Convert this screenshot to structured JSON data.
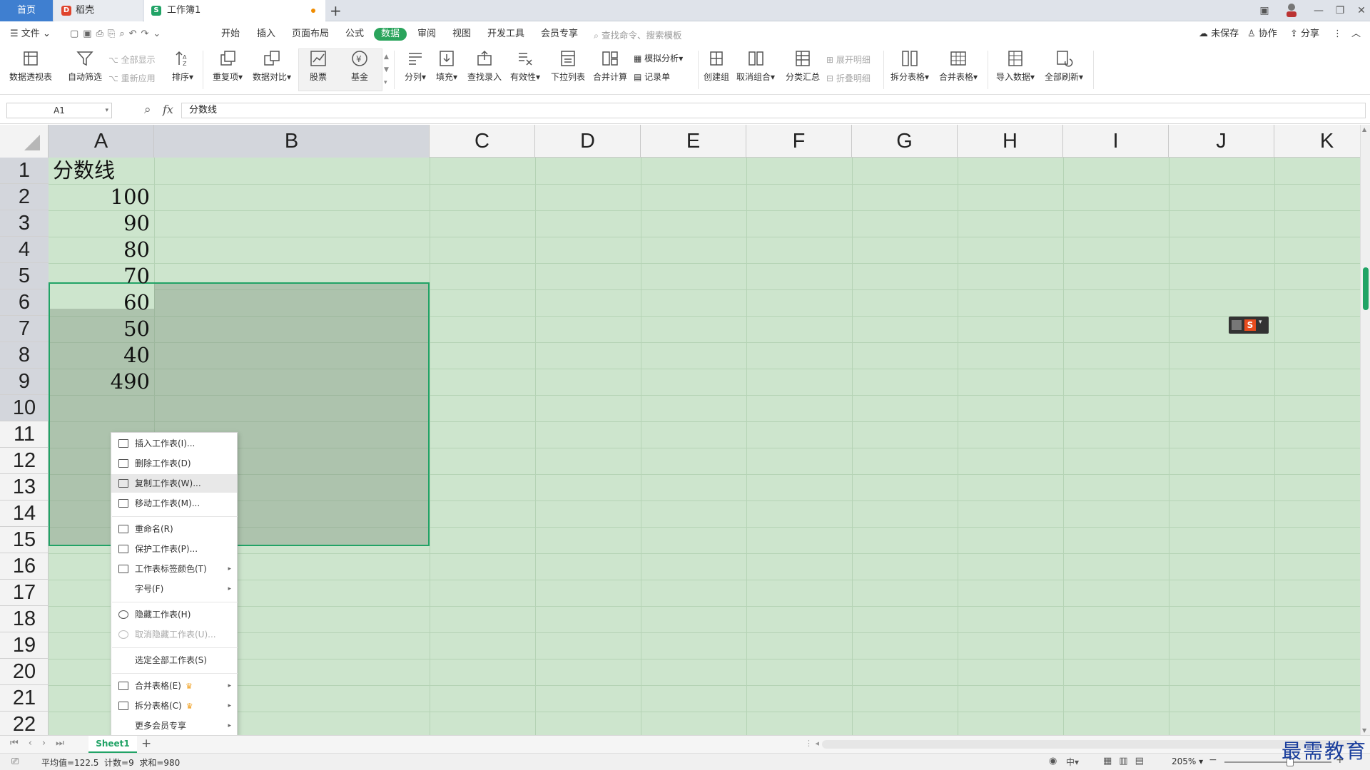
{
  "titlebar": {
    "tab_home": "首页",
    "tab_docer": "稻壳",
    "tab_doc": "工作簿1",
    "new_tab": "+"
  },
  "menu": {
    "file": "文件",
    "items": [
      "开始",
      "插入",
      "页面布局",
      "公式",
      "数据",
      "审阅",
      "视图",
      "开发工具",
      "会员专享"
    ],
    "active": "数据",
    "search_placeholder": "查找命令、搜索模板",
    "unsaved": "未保存",
    "collab": "协作",
    "share": "分享"
  },
  "ribbon": {
    "pivot": "数据透视表",
    "autofilter": "自动筛选",
    "show_all": "全部显示",
    "reapply": "重新应用",
    "sort": "排序",
    "duplicates": "重复项",
    "compare": "数据对比",
    "stock": "股票",
    "fund": "基金",
    "split_col": "分列",
    "fill": "填充",
    "lookup": "查找录入",
    "validity": "有效性",
    "dropdown": "下拉列表",
    "consolidate": "合并计算",
    "whatif": "模拟分析",
    "record": "记录单",
    "group": "创建组",
    "ungroup": "取消组合",
    "subtotal": "分类汇总",
    "expand": "展开明细",
    "collapse": "折叠明细",
    "split_table": "拆分表格",
    "merge_table": "合并表格",
    "import": "导入数据",
    "refresh_all": "全部刷新"
  },
  "formula_bar": {
    "name_box": "A1",
    "fx": "fx",
    "content": "分数线"
  },
  "columns": [
    "A",
    "B",
    "C",
    "D",
    "E",
    "F",
    "G",
    "H",
    "I",
    "J",
    "K"
  ],
  "rows": [
    "1",
    "2",
    "3",
    "4",
    "5",
    "6",
    "7",
    "8",
    "9",
    "10",
    "11",
    "12",
    "13",
    "14",
    "15",
    "16",
    "17",
    "18",
    "19",
    "20",
    "21",
    "22"
  ],
  "cells": {
    "A1": "分数线",
    "A2": "100",
    "A3": "90",
    "A4": "80",
    "A5": "70",
    "A6": "60",
    "A7": "50",
    "A8": "40",
    "A9": "490"
  },
  "context_menu": [
    {
      "label": "插入工作表(I)..."
    },
    {
      "label": "删除工作表(D)"
    },
    {
      "label": "复制工作表(W)..."
    },
    {
      "label": "移动工作表(M)..."
    },
    {
      "label": "重命名(R)"
    },
    {
      "label": "保护工作表(P)..."
    },
    {
      "label": "工作表标签颜色(T)"
    },
    {
      "label": "字号(F)"
    },
    {
      "label": "隐藏工作表(H)"
    },
    {
      "label": "取消隐藏工作表(U)..."
    },
    {
      "label": "选定全部工作表(S)"
    },
    {
      "label": "合并表格(E)"
    },
    {
      "label": "拆分表格(C)"
    },
    {
      "label": "更多会员专享"
    }
  ],
  "sheet_tabs": {
    "active": "Sheet1",
    "add": "+"
  },
  "status": {
    "text": "平均值=122.5  计数=9  求和=980",
    "zoom": "205%"
  },
  "watermark": "最需教育"
}
